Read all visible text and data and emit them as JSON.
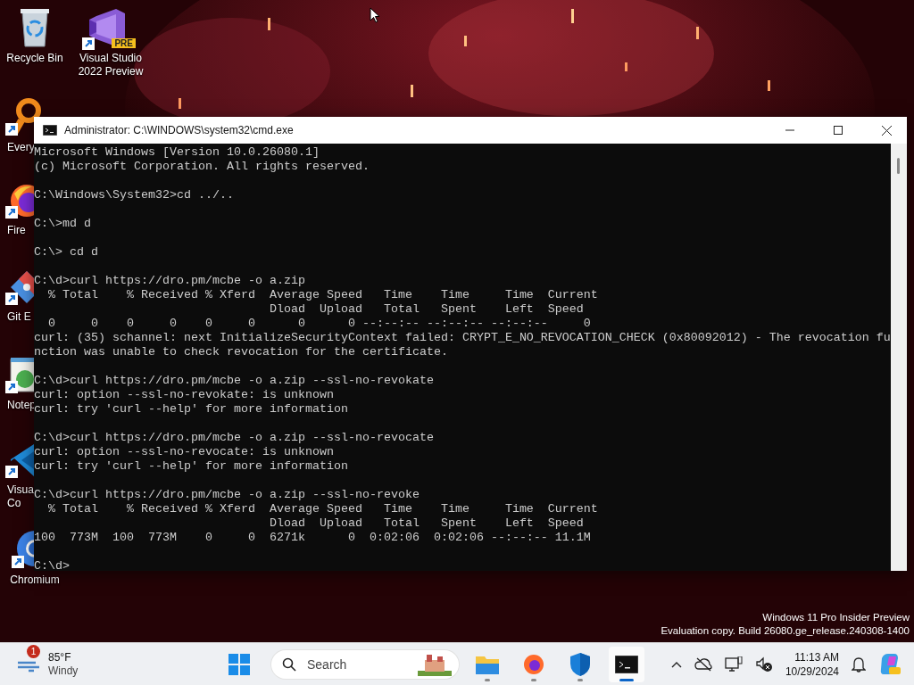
{
  "desktop": {
    "top_icons": [
      {
        "kind": "recycle",
        "lines": [
          "Recycle Bin"
        ],
        "shortcut": false
      },
      {
        "kind": "vs",
        "lines": [
          "Visual Studio",
          "2022 Preview"
        ],
        "shortcut": true,
        "badge": "PRE"
      }
    ],
    "side_icons": [
      {
        "kind": "everything",
        "lines": [
          "Every"
        ],
        "shortcut": true
      },
      {
        "kind": "firefox",
        "lines": [
          "Fire"
        ],
        "shortcut": true
      },
      {
        "kind": "git",
        "lines": [
          "Git E"
        ],
        "shortcut": true
      },
      {
        "kind": "notepad",
        "lines": [
          "Notep"
        ],
        "shortcut": true
      },
      {
        "kind": "vscode",
        "lines": [
          "Visual",
          "Co"
        ],
        "shortcut": true
      },
      {
        "kind": "chromium",
        "lines": [
          "Chromium"
        ],
        "shortcut": true
      }
    ],
    "watermark": [
      "Windows 11 Pro Insider Preview",
      "Evaluation copy. Build 26080.ge_release.240308-1400"
    ]
  },
  "window": {
    "title": "Administrator: C:\\WINDOWS\\system32\\cmd.exe",
    "console": [
      [
        "Microsoft Windows [Version 10.0.26080.1]",
        "(c) Microsoft Corporation. All rights reserved."
      ],
      [
        "C:\\Windows\\System32>cd ../.."
      ],
      [
        "C:\\>md d"
      ],
      [
        "C:\\> cd d"
      ],
      [
        "C:\\d>curl https://dro.pm/mcbe -o a.zip",
        "  % Total    % Received % Xferd  Average Speed   Time    Time     Time  Current",
        "                                 Dload  Upload   Total   Spent    Left  Speed",
        "  0     0    0     0    0     0      0      0 --:--:-- --:--:-- --:--:--     0",
        "curl: (35) schannel: next InitializeSecurityContext failed: CRYPT_E_NO_REVOCATION_CHECK (0x80092012) - The revocation fu",
        "nction was unable to check revocation for the certificate."
      ],
      [
        "C:\\d>curl https://dro.pm/mcbe -o a.zip --ssl-no-revokate",
        "curl: option --ssl-no-revokate: is unknown",
        "curl: try 'curl --help' for more information"
      ],
      [
        "C:\\d>curl https://dro.pm/mcbe -o a.zip --ssl-no-revocate",
        "curl: option --ssl-no-revocate: is unknown",
        "curl: try 'curl --help' for more information"
      ],
      [
        "C:\\d>curl https://dro.pm/mcbe -o a.zip --ssl-no-revoke",
        "  % Total    % Received % Xferd  Average Speed   Time    Time     Time  Current",
        "                                 Dload  Upload   Total   Spent    Left  Speed",
        "100  773M  100  773M    0     0  6271k      0  0:02:06  0:02:06 --:--:-- 11.1M"
      ],
      [
        "C:\\d>"
      ]
    ]
  },
  "taskbar": {
    "weather": {
      "badge": "1",
      "temperature": "85°F",
      "condition": "Windy"
    },
    "search": {
      "placeholder": "Search"
    },
    "apps": [
      {
        "kind": "explorer",
        "selected": false
      },
      {
        "kind": "firefox",
        "selected": false
      },
      {
        "kind": "defender",
        "selected": false
      },
      {
        "kind": "terminal",
        "selected": true
      }
    ],
    "time": "11:13 AM",
    "date": "10/29/2024"
  }
}
